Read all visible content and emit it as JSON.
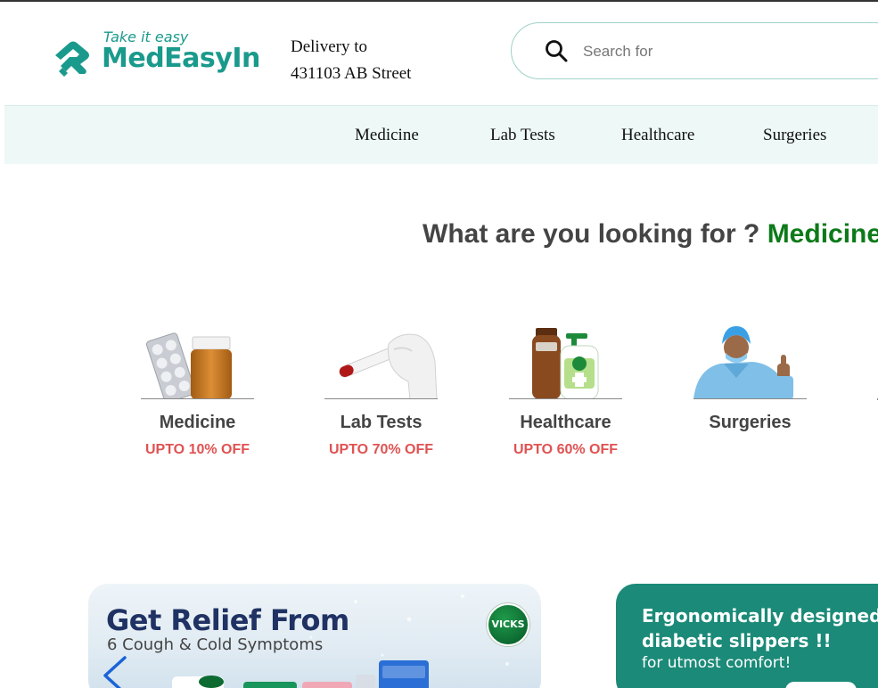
{
  "header": {
    "logo": {
      "tagline": "Take it easy",
      "name": "MedEasyIn"
    },
    "delivery": {
      "label": "Delivery to",
      "address": "431103 AB Street"
    },
    "search": {
      "placeholder": "Search for"
    }
  },
  "nav": {
    "items": [
      {
        "label": "Medicine"
      },
      {
        "label": "Lab Tests"
      },
      {
        "label": "Healthcare"
      },
      {
        "label": "Surgeries"
      }
    ]
  },
  "section": {
    "heading_prefix": "What are you looking for ?",
    "heading_accent": "Medicine"
  },
  "categories": [
    {
      "title": "Medicine",
      "offer": "UPTO 10% OFF",
      "icon": "medicine-icon"
    },
    {
      "title": "Lab Tests",
      "offer": "UPTO 70% OFF",
      "icon": "lab-test-tube-icon"
    },
    {
      "title": "Healthcare",
      "offer": "UPTO 60% OFF",
      "icon": "healthcare-products-icon"
    },
    {
      "title": "Surgeries",
      "offer": "",
      "icon": "surgeon-icon"
    }
  ],
  "banners": [
    {
      "title": "Get Relief From",
      "subtitle": "6 Cough & Cold Symptoms",
      "brand": "VICKS"
    },
    {
      "line1": "Ergonomically designed",
      "line2": "diabetic slippers !!",
      "line3": "for utmost comfort!"
    }
  ],
  "colors": {
    "brand": "#1a9a8c",
    "nav_background": "#edf8f7",
    "accent_green": "#0d7a19",
    "offer_red": "#e05252",
    "banner_teal": "#1b8a78"
  }
}
